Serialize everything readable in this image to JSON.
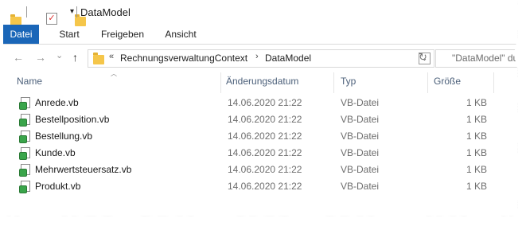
{
  "window": {
    "title": "DataModel"
  },
  "ribbon": {
    "tabs": [
      {
        "label": "Datei",
        "active": true
      },
      {
        "label": "Start",
        "active": false
      },
      {
        "label": "Freigeben",
        "active": false
      },
      {
        "label": "Ansicht",
        "active": false
      }
    ],
    "accent_color": "#1a66b8"
  },
  "address": {
    "overflow": "«",
    "crumbs": [
      "RechnungsverwaltungContext",
      "DataModel"
    ],
    "separator": "›"
  },
  "search": {
    "placeholder": "\"DataModel\" du"
  },
  "columns": {
    "name": "Name",
    "date": "Änderungsdatum",
    "type": "Typ",
    "size": "Größe"
  },
  "files": [
    {
      "name": "Anrede.vb",
      "date": "14.06.2020 21:22",
      "type": "VB-Datei",
      "size": "1 KB"
    },
    {
      "name": "Bestellposition.vb",
      "date": "14.06.2020 21:22",
      "type": "VB-Datei",
      "size": "1 KB"
    },
    {
      "name": "Bestellung.vb",
      "date": "14.06.2020 21:22",
      "type": "VB-Datei",
      "size": "1 KB"
    },
    {
      "name": "Kunde.vb",
      "date": "14.06.2020 21:22",
      "type": "VB-Datei",
      "size": "1 KB"
    },
    {
      "name": "Mehrwertsteuersatz.vb",
      "date": "14.06.2020 21:22",
      "type": "VB-Datei",
      "size": "1 KB"
    },
    {
      "name": "Produkt.vb",
      "date": "14.06.2020 21:22",
      "type": "VB-Datei",
      "size": "1 KB"
    }
  ],
  "icons": {
    "back": "←",
    "forward": "→",
    "recent": "⌄",
    "up": "↑",
    "refresh": "↻",
    "dropdown": "⌄"
  }
}
